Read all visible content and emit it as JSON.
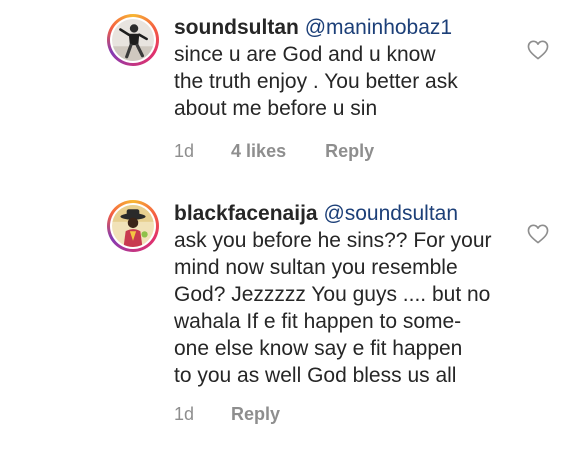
{
  "comments": [
    {
      "username": "soundsultan",
      "mention": "@maninhobaz1",
      "lines": [
        "since u are God and u know",
        "the truth  enjoy . You better ask",
        "about me before u sin"
      ],
      "time": "1d",
      "likes": "4 likes",
      "reply": "Reply",
      "avatar_icon": "person-pose-avatar",
      "like_icon": "heart-outline-icon"
    },
    {
      "username": "blackfacenaija",
      "mention": "@soundsultan",
      "lines": [
        "ask you before he sins?? For your",
        "mind now sultan you resemble",
        "God? Jezzzzz You guys .... but no",
        "wahala If e fit happen to some-",
        "one else know say e fit happen",
        "to you as well God bless us all"
      ],
      "time": "1d",
      "reply": "Reply",
      "avatar_icon": "hat-person-avatar",
      "like_icon": "heart-outline-icon"
    }
  ],
  "colors": {
    "text": "#262626",
    "mention": "#1c3f78",
    "meta": "#8e8e8e",
    "story_ring": "#e1306c"
  }
}
